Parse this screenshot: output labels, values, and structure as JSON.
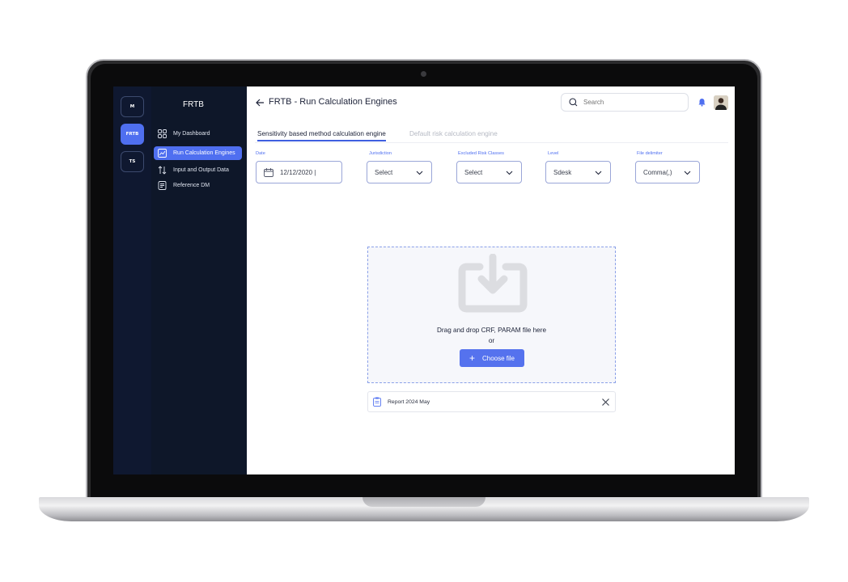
{
  "app": {
    "rail": [
      "M",
      "FRTB",
      "TS"
    ],
    "nav_title": "FRTB",
    "nav_items": [
      {
        "label": "My Dashboard",
        "icon": "dashboard-grid-icon"
      },
      {
        "label": "Run Calculation Engines",
        "icon": "chart-line-icon"
      },
      {
        "label": "Input and Output Data",
        "icon": "arrows-up-down-icon"
      },
      {
        "label": "Reference DM",
        "icon": "document-list-icon"
      }
    ]
  },
  "header": {
    "title": "FRTB - Run Calculation Engines",
    "search_placeholder": "Search"
  },
  "tabs": [
    {
      "label": "Sensitivity based method calculation engine",
      "active": true
    },
    {
      "label": "Default risk calculation engine",
      "active": false
    }
  ],
  "filters": {
    "date": {
      "label": "Date",
      "value": "12/12/2020 |"
    },
    "jurisdiction": {
      "label": "Jurisdiction",
      "value": "Select"
    },
    "excluded": {
      "label": "Excluded Risk Classes",
      "value": "Select"
    },
    "level": {
      "label": "Level",
      "value": "Sdesk"
    },
    "delimiter": {
      "label": "File delimiter",
      "value": "Comma(,)"
    }
  },
  "upload": {
    "prompt": "Drag and drop CRF, PARAM file here",
    "or": "or",
    "button": "Choose file"
  },
  "file": {
    "name": "Report 2024 May"
  },
  "colors": {
    "accent": "#4f6ff0",
    "sidebar": "#0e1729",
    "rail": "#0f1830"
  }
}
